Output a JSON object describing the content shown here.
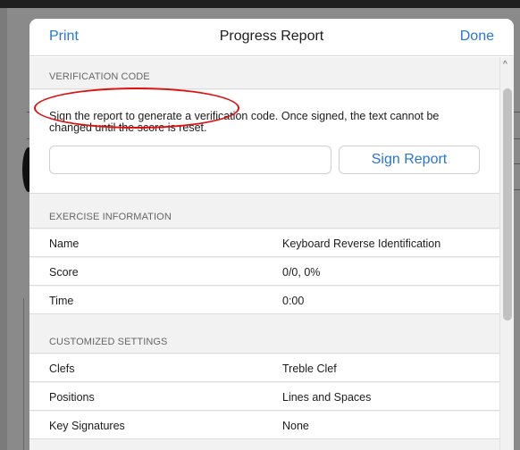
{
  "header": {
    "left_label": "Print",
    "title": "Progress Report",
    "right_label": "Done"
  },
  "verification": {
    "section_title": "VERIFICATION CODE",
    "description": "Sign the report to generate a verification code. Once signed, the text cannot be changed until the score is reset.",
    "code_value": "",
    "sign_button_label": "Sign Report"
  },
  "exercise": {
    "section_title": "EXERCISE INFORMATION",
    "rows": [
      {
        "label": "Name",
        "value": "Keyboard Reverse Identification"
      },
      {
        "label": "Score",
        "value": "0/0, 0%"
      },
      {
        "label": "Time",
        "value": "0:00"
      }
    ]
  },
  "settings": {
    "section_title": "CUSTOMIZED SETTINGS",
    "rows": [
      {
        "label": "Clefs",
        "value": "Treble Clef"
      },
      {
        "label": "Positions",
        "value": "Lines and Spaces"
      },
      {
        "label": "Key Signatures",
        "value": "None"
      }
    ]
  },
  "colors": {
    "accent": "#2a74d9",
    "highlight": "#dd1111"
  }
}
